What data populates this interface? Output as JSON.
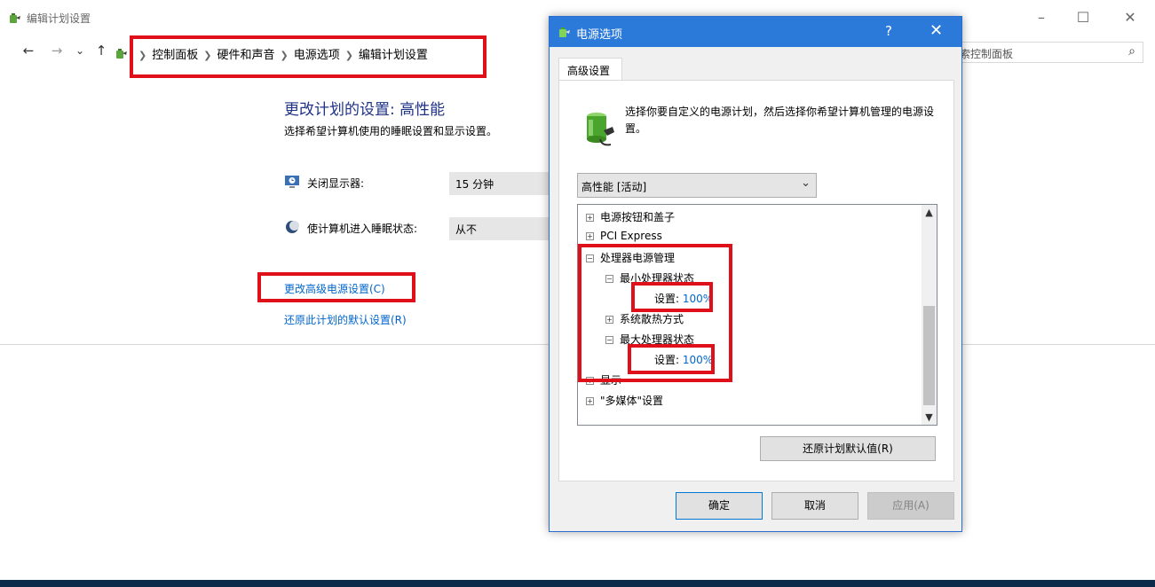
{
  "window": {
    "title": "编辑计划设置",
    "controls": {
      "minimize": "–",
      "maximize": "☐",
      "close": "✕"
    }
  },
  "nav": {
    "back": "←",
    "forward": "→",
    "history": "⌄",
    "up": "↑",
    "breadcrumb": [
      "控制面板",
      "硬件和声音",
      "电源选项",
      "编辑计划设置"
    ],
    "search_placeholder": "索控制面板",
    "search_icon": "⌕"
  },
  "content": {
    "heading": "更改计划的设置: 高性能",
    "subheading": "选择希望计算机使用的睡眠设置和显示设置。",
    "display_off_label": "关闭显示器:",
    "display_off_value": "15 分钟",
    "sleep_label": "使计算机进入睡眠状态:",
    "sleep_value": "从不",
    "advanced_link": "更改高级电源设置(C)",
    "restore_link": "还原此计划的默认设置(R)"
  },
  "dialog": {
    "title": "电源选项",
    "help": "?",
    "close": "✕",
    "tab": "高级设置",
    "description": "选择你要自定义的电源计划，然后选择你希望计算机管理的电源设置。",
    "plan_selected": "高性能 [活动]",
    "tree": [
      {
        "expander": "+",
        "label": "电源按钮和盖子"
      },
      {
        "expander": "+",
        "label": "PCI Express"
      },
      {
        "expander": "−",
        "label": "处理器电源管理"
      },
      {
        "expander": "−",
        "label": "最小处理器状态"
      },
      {
        "setting_label": "设置:",
        "setting_value": "100%"
      },
      {
        "expander": "+",
        "label": "系统散热方式"
      },
      {
        "expander": "−",
        "label": "最大处理器状态"
      },
      {
        "setting_label": "设置:",
        "setting_value": "100%"
      },
      {
        "expander": "+",
        "label": "显示"
      },
      {
        "expander": "+",
        "label": "\"多媒体\"设置"
      }
    ],
    "restore_defaults": "还原计划默认值(R)",
    "ok": "确定",
    "cancel": "取消",
    "apply": "应用(A)"
  },
  "colors": {
    "highlight_box": "#e0101b",
    "dialog_title_bar": "#2b79d8",
    "link": "#0066cc",
    "heading": "#1e3287"
  }
}
